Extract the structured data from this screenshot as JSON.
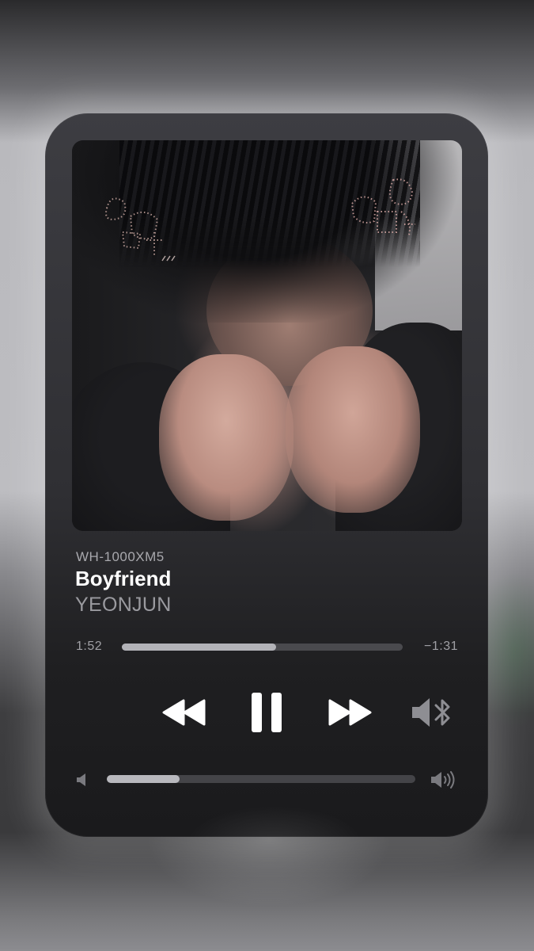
{
  "player": {
    "device": "WH-1000XM5",
    "title": "Boyfriend",
    "artist": "YEONJUN",
    "elapsed": "1:52",
    "remaining": "−1:31",
    "progress": 0.55,
    "volume": 0.235
  },
  "controls": {
    "rewind_icon": "rewind-icon",
    "pause_icon": "pause-icon",
    "fast_forward_icon": "fast-forward-icon",
    "audio_output_icon": "speaker-bluetooth-icon",
    "volume_low_icon": "speaker-low-icon",
    "volume_high_icon": "speaker-high-icon"
  },
  "colors": {
    "title": "#ffffff",
    "secondary_text": "#9a9a9f",
    "track": "#4a4a4e",
    "fill": "#b3b3b8"
  }
}
